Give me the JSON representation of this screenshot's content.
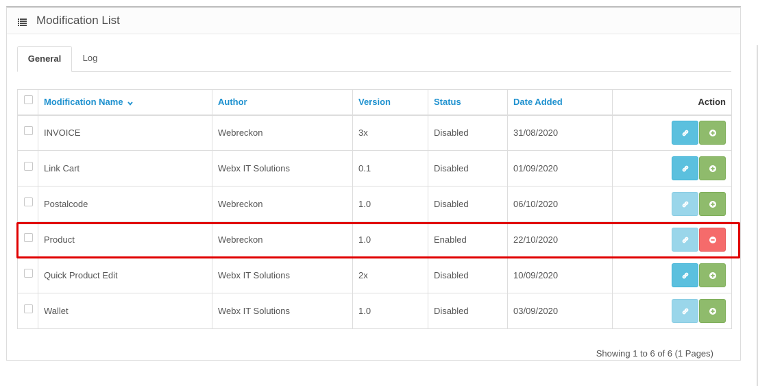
{
  "panel": {
    "title": "Modification List",
    "icon": "list-icon"
  },
  "tabs": [
    {
      "label": "General",
      "active": true
    },
    {
      "label": "Log",
      "active": false
    }
  ],
  "table": {
    "headers": {
      "name": "Modification Name",
      "author": "Author",
      "version": "Version",
      "status": "Status",
      "date_added": "Date Added",
      "action": "Action"
    },
    "sort_indicator": "chevron-down-icon",
    "rows": [
      {
        "name": "INVOICE",
        "author": "Webreckon",
        "version": "3x",
        "status": "Disabled",
        "date_added": "31/08/2020",
        "link_enabled": true,
        "toggle": "enable"
      },
      {
        "name": "Link Cart",
        "author": "Webx IT Solutions",
        "version": "0.1",
        "status": "Disabled",
        "date_added": "01/09/2020",
        "link_enabled": true,
        "toggle": "enable"
      },
      {
        "name": "Postalcode",
        "author": "Webreckon",
        "version": "1.0",
        "status": "Disabled",
        "date_added": "06/10/2020",
        "link_enabled": false,
        "toggle": "enable"
      },
      {
        "name": "Product",
        "author": "Webreckon",
        "version": "1.0",
        "status": "Enabled",
        "date_added": "22/10/2020",
        "link_enabled": false,
        "toggle": "disable"
      },
      {
        "name": "Quick Product Edit",
        "author": "Webx IT Solutions",
        "version": "2x",
        "status": "Disabled",
        "date_added": "10/09/2020",
        "link_enabled": true,
        "toggle": "enable"
      },
      {
        "name": "Wallet",
        "author": "Webx IT Solutions",
        "version": "1.0",
        "status": "Disabled",
        "date_added": "03/09/2020",
        "link_enabled": false,
        "toggle": "enable"
      }
    ]
  },
  "pagination": {
    "text": "Showing 1 to 6 of 6 (1 Pages)"
  },
  "colors": {
    "link_header": "#1e91cf",
    "btn_info": "#5bc0de",
    "btn_success": "#8fbb6c",
    "btn_danger": "#f56b6b",
    "highlight": "#e00000"
  }
}
